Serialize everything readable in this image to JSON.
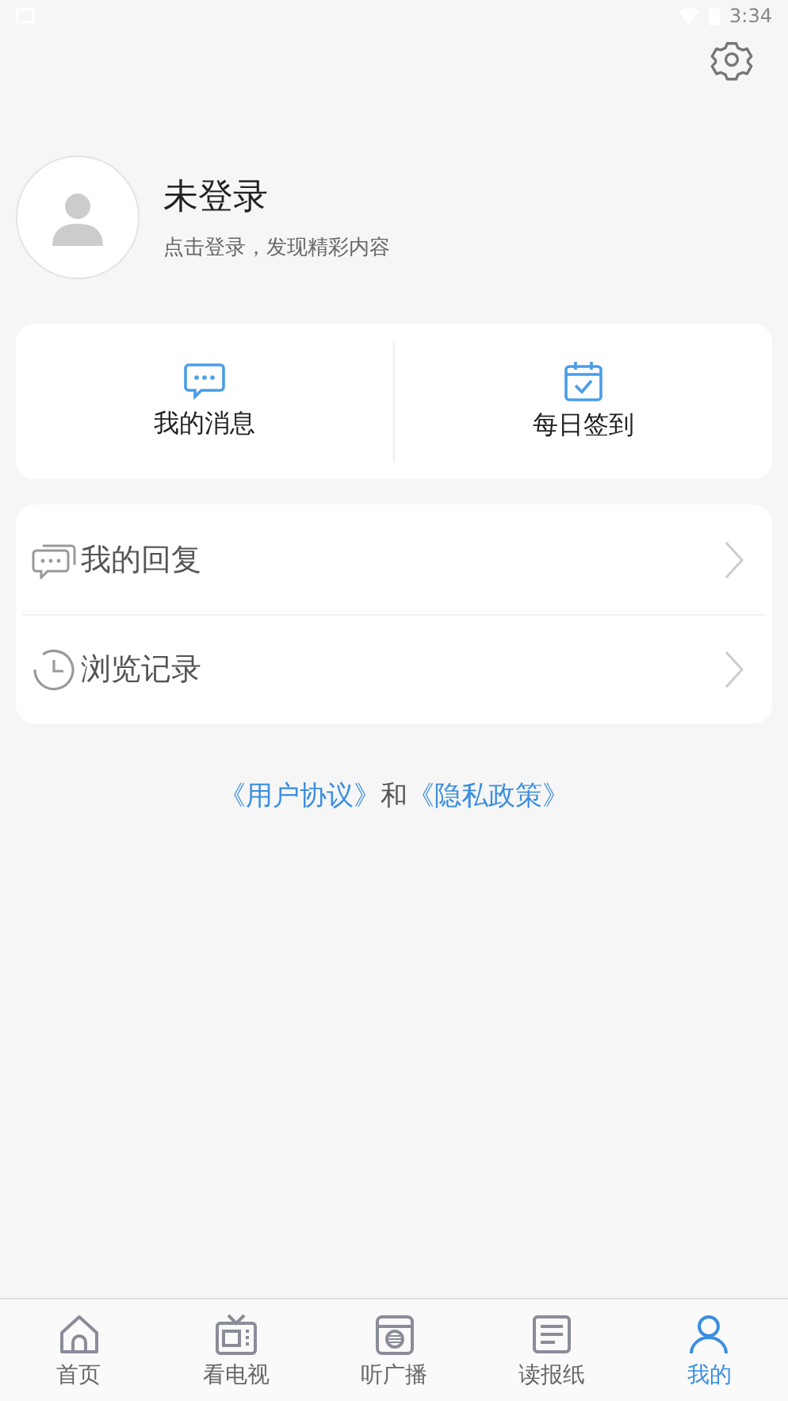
{
  "status_bar": {
    "time": "3:34"
  },
  "profile": {
    "name": "未登录",
    "hint": "点击登录，发现精彩内容"
  },
  "quick_actions": [
    {
      "label": "我的消息",
      "kind": "message"
    },
    {
      "label": "每日签到",
      "kind": "calendar"
    }
  ],
  "menu": [
    {
      "label": "我的回复",
      "kind": "reply"
    },
    {
      "label": "浏览记录",
      "kind": "history"
    }
  ],
  "agreement": [
    {
      "text": "《用户协议》",
      "kind": "link"
    },
    {
      "text": "和",
      "kind": "text"
    },
    {
      "text": "《隐私政策》",
      "kind": "link"
    }
  ],
  "tabs": [
    {
      "label": "首页",
      "kind": "home",
      "selected": false
    },
    {
      "label": "看电视",
      "kind": "tv",
      "selected": false
    },
    {
      "label": "听广播",
      "kind": "radio",
      "selected": false
    },
    {
      "label": "读报纸",
      "kind": "paper",
      "selected": false
    },
    {
      "label": "我的",
      "kind": "me",
      "selected": true
    }
  ]
}
